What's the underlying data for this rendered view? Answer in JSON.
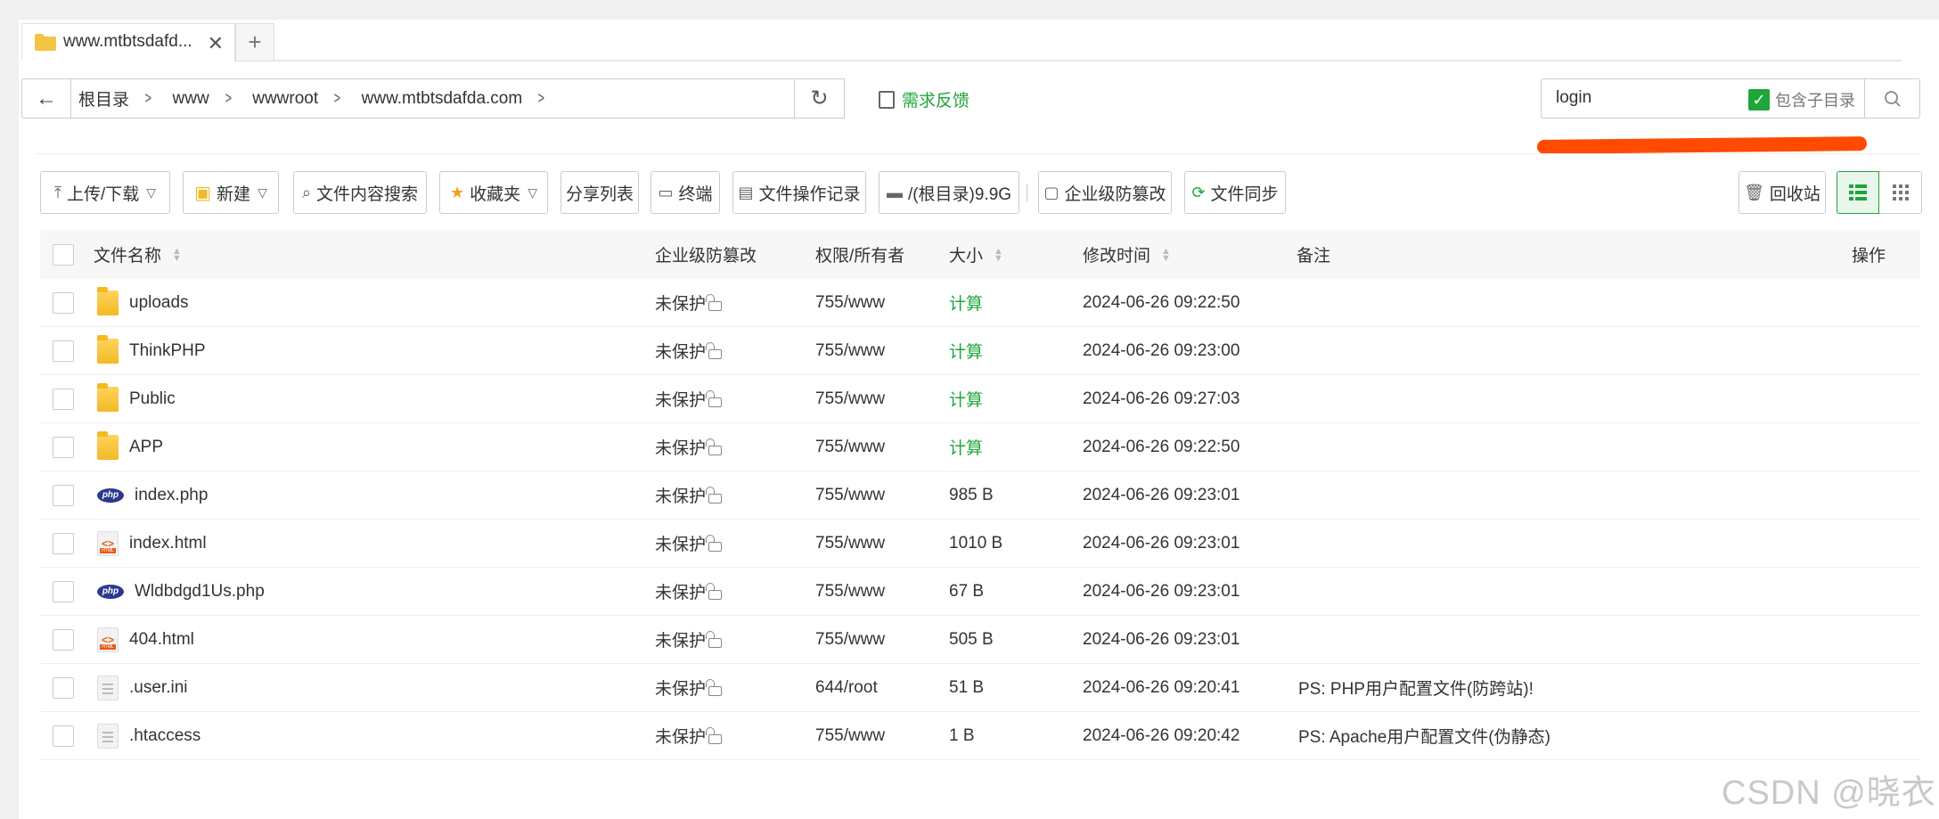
{
  "tab": {
    "title": "www.mtbtsdafd...",
    "close": "✕",
    "add": "+"
  },
  "path": {
    "back": "←",
    "crumbs": [
      "根目录",
      "www",
      "wwwroot",
      "www.mtbtsdafda.com"
    ],
    "refresh": "↻"
  },
  "feedback_label": "需求反馈",
  "search": {
    "value": "login",
    "include_subdir_label": "包含子目录",
    "include_subdir_checked": true
  },
  "toolbar": {
    "upload": "上传/下载",
    "new": "新建",
    "content_search": "文件内容搜索",
    "favorites": "收藏夹",
    "share_list": "分享列表",
    "terminal": "终端",
    "op_log": "文件操作记录",
    "disk": "/(根目录)9.9G",
    "tamper": "企业级防篡改",
    "sync": "文件同步",
    "recycle": "回收站"
  },
  "columns": {
    "name": "文件名称",
    "tamper": "企业级防篡改",
    "perm": "权限/所有者",
    "size": "大小",
    "mtime": "修改时间",
    "remark": "备注",
    "action": "操作"
  },
  "files": [
    {
      "type": "folder",
      "name": "uploads",
      "tamper": "未保护",
      "perm": "755/www",
      "size": "计算",
      "size_calc": true,
      "mtime": "2024-06-26 09:22:50",
      "remark": ""
    },
    {
      "type": "folder",
      "name": "ThinkPHP",
      "tamper": "未保护",
      "perm": "755/www",
      "size": "计算",
      "size_calc": true,
      "mtime": "2024-06-26 09:23:00",
      "remark": ""
    },
    {
      "type": "folder",
      "name": "Public",
      "tamper": "未保护",
      "perm": "755/www",
      "size": "计算",
      "size_calc": true,
      "mtime": "2024-06-26 09:27:03",
      "remark": ""
    },
    {
      "type": "folder",
      "name": "APP",
      "tamper": "未保护",
      "perm": "755/www",
      "size": "计算",
      "size_calc": true,
      "mtime": "2024-06-26 09:22:50",
      "remark": ""
    },
    {
      "type": "php",
      "name": "index.php",
      "tamper": "未保护",
      "perm": "755/www",
      "size": "985 B",
      "size_calc": false,
      "mtime": "2024-06-26 09:23:01",
      "remark": ""
    },
    {
      "type": "html",
      "name": "index.html",
      "tamper": "未保护",
      "perm": "755/www",
      "size": "1010 B",
      "size_calc": false,
      "mtime": "2024-06-26 09:23:01",
      "remark": ""
    },
    {
      "type": "php",
      "name": "Wldbdgd1Us.php",
      "tamper": "未保护",
      "perm": "755/www",
      "size": "67 B",
      "size_calc": false,
      "mtime": "2024-06-26 09:23:01",
      "remark": ""
    },
    {
      "type": "html",
      "name": "404.html",
      "tamper": "未保护",
      "perm": "755/www",
      "size": "505 B",
      "size_calc": false,
      "mtime": "2024-06-26 09:23:01",
      "remark": ""
    },
    {
      "type": "text",
      "name": ".user.ini",
      "tamper": "未保护",
      "perm": "644/root",
      "size": "51 B",
      "size_calc": false,
      "mtime": "2024-06-26 09:20:41",
      "remark": "PS: PHP用户配置文件(防跨站)!"
    },
    {
      "type": "text",
      "name": ".htaccess",
      "tamper": "未保护",
      "perm": "755/www",
      "size": "1 B",
      "size_calc": false,
      "mtime": "2024-06-26 09:20:42",
      "remark": "PS: Apache用户配置文件(伪静态)"
    }
  ],
  "colors": {
    "accent": "#20a53a",
    "annotation": "#ff4a00"
  },
  "watermark": "CSDN @晓衣"
}
